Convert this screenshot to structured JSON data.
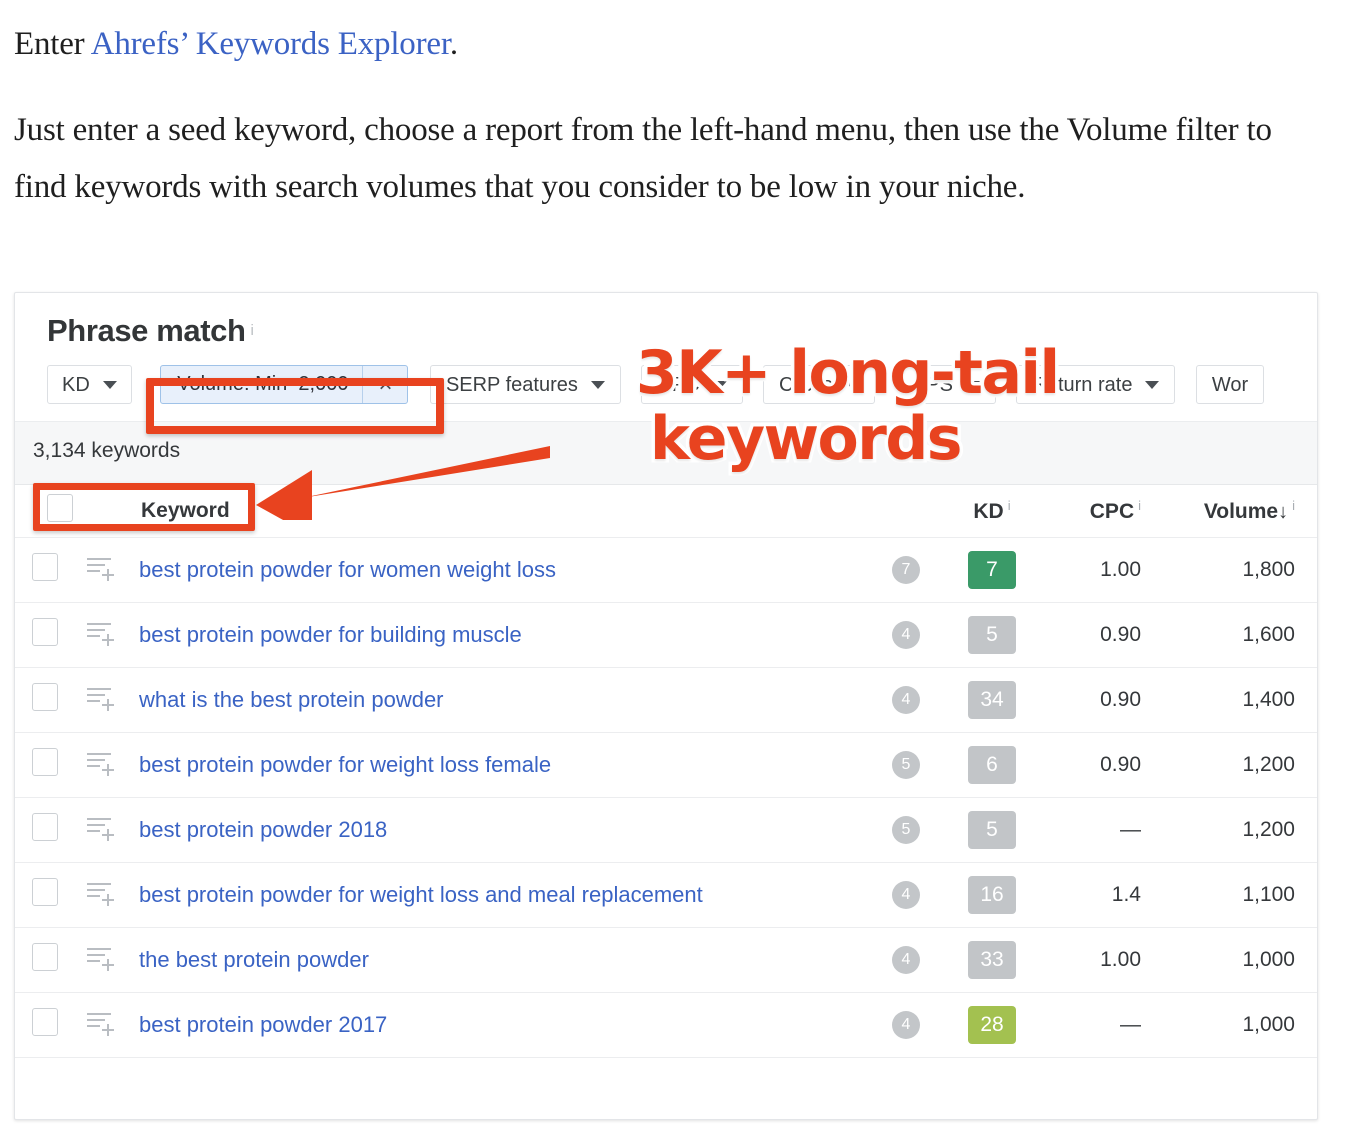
{
  "article": {
    "paragraph1_prefix": "Enter ",
    "paragraph1_link": "Ahrefs’ Keywords Explorer",
    "paragraph1_suffix": ".",
    "paragraph2": "Just enter a seed keyword, choose a report from the left‑hand menu, then use the Volume filter to find keywords with search volumes that you consider to be low in your niche."
  },
  "screenshot": {
    "title": "Phrase match",
    "title_info": "i",
    "filters": {
      "kd": "KD",
      "volume_active": "Volume: Min–2,000",
      "volume_clear": "×",
      "serp_features": "SERP features",
      "cpc": "CPC",
      "clicks": "Clicks",
      "cps": "CPS",
      "return_rate": "Return rate",
      "words": "Wor"
    },
    "count_label": "3,134 keywords",
    "table": {
      "headers": {
        "keyword": "Keyword",
        "kd": "KD",
        "cpc": "CPC",
        "volume": "Volume",
        "volume_sort": "↓",
        "info": "i"
      },
      "rows": [
        {
          "keyword": "best protein powder for women weight loss",
          "dot": "7",
          "kd": "7",
          "kd_color": "#3a9a68",
          "cpc": "1.00",
          "volume": "1,800"
        },
        {
          "keyword": "best protein powder for building muscle",
          "dot": "4",
          "kd": "5",
          "kd_color": "#c2c5c8",
          "cpc": "0.90",
          "volume": "1,600"
        },
        {
          "keyword": "what is the best protein powder",
          "dot": "4",
          "kd": "34",
          "kd_color": "#c2c5c8",
          "cpc": "0.90",
          "volume": "1,400"
        },
        {
          "keyword": "best protein powder for weight loss female",
          "dot": "5",
          "kd": "6",
          "kd_color": "#c2c5c8",
          "cpc": "0.90",
          "volume": "1,200"
        },
        {
          "keyword": "best protein powder 2018",
          "dot": "5",
          "kd": "5",
          "kd_color": "#c2c5c8",
          "cpc": "—",
          "volume": "1,200"
        },
        {
          "keyword": "best protein powder for weight loss and meal replacement",
          "dot": "4",
          "kd": "16",
          "kd_color": "#c2c5c8",
          "cpc": "1.4",
          "volume": "1,100"
        },
        {
          "keyword": "the best protein powder",
          "dot": "4",
          "kd": "33",
          "kd_color": "#c2c5c8",
          "cpc": "1.00",
          "volume": "1,000"
        },
        {
          "keyword": "best protein powder 2017",
          "dot": "4",
          "kd": "28",
          "kd_color": "#a3c150",
          "cpc": "—",
          "volume": "1,000"
        }
      ]
    }
  },
  "annotation": {
    "line1": "3K+ long-tail",
    "line2": "keywords",
    "color": "#e8431f"
  },
  "colors": {
    "accent_red": "#e8431f",
    "link_blue": "#3a63c4",
    "kd_green": "#3a9a68",
    "kd_yellow_green": "#a3c150",
    "kd_gray": "#c2c5c8"
  }
}
